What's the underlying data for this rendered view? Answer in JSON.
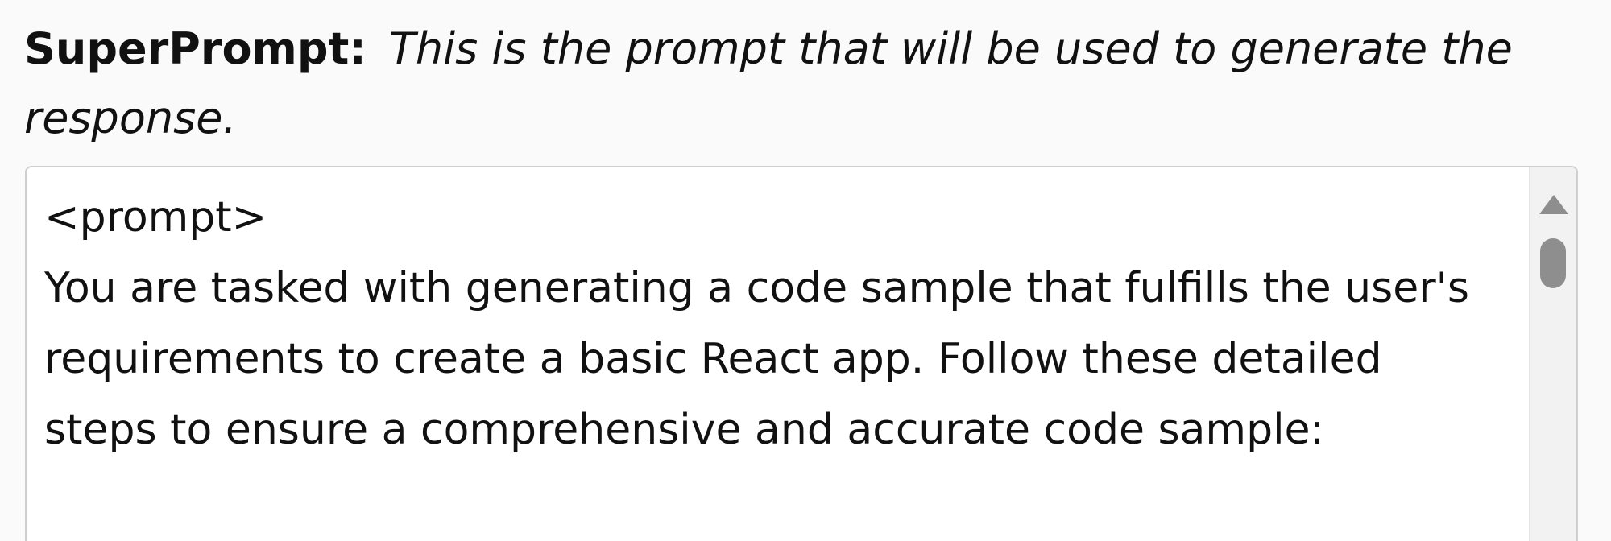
{
  "field": {
    "label": "SuperPrompt:",
    "description": "This is the prompt that will be used to generate the response.",
    "value": "<prompt>\nYou are tasked with generating a code sample that fulfills the user's requirements to create a basic React app. Follow these detailed steps to ensure a comprehensive and accurate code sample:"
  },
  "icons": {
    "scroll_up": "triangle-up-icon"
  },
  "colors": {
    "background": "#fafafa",
    "box_border": "#cfcfcf",
    "scrollbar_thumb": "#8e8e8e"
  }
}
